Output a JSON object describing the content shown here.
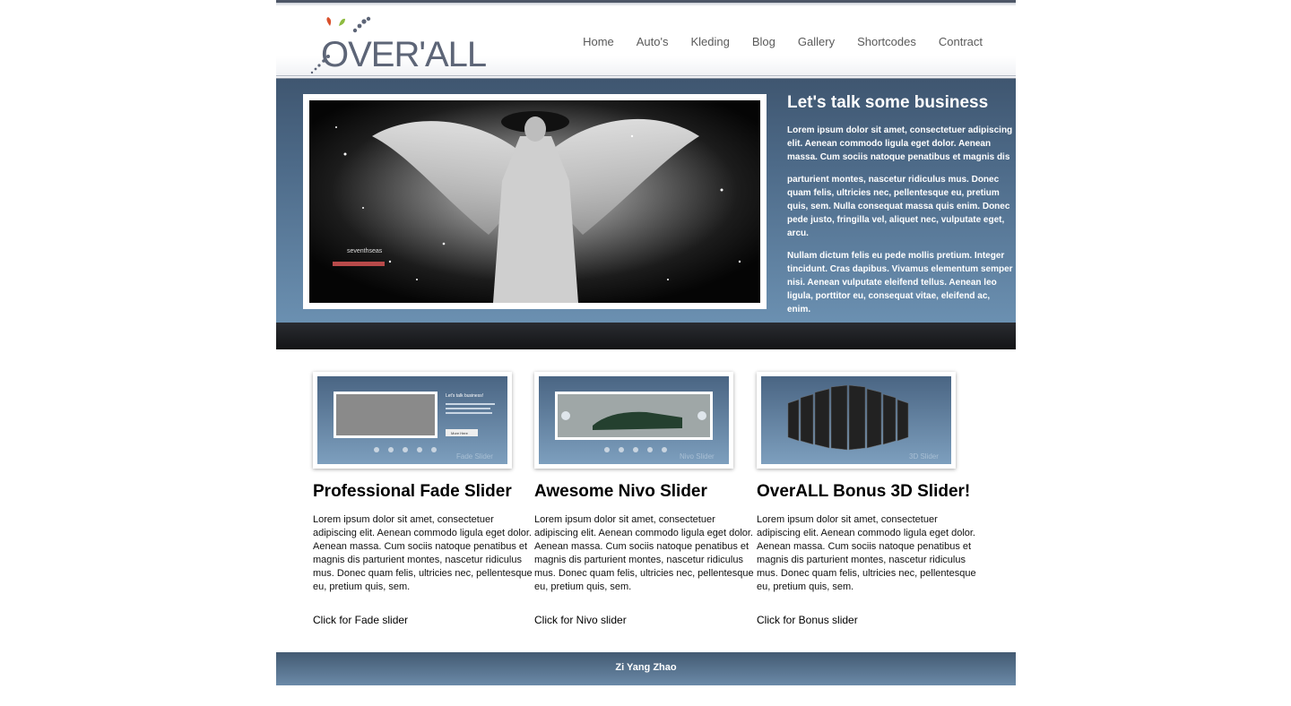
{
  "logo": {
    "text": "OVER'ALL"
  },
  "nav": {
    "items": [
      "Home",
      "Auto's",
      "Kleding",
      "Blog",
      "Gallery",
      "Shortcodes",
      "Contract"
    ]
  },
  "hero": {
    "title": "Let's talk some business",
    "paragraphs": [
      "Lorem ipsum dolor sit amet, consectetuer adipiscing elit. Aenean commodo ligula eget dolor. Aenean massa. Cum sociis natoque penatibus et magnis dis",
      "parturient montes, nascetur ridiculus mus. Donec quam felis, ultricies nec, pellentesque eu, pretium quis, sem. Nulla consequat massa quis enim. Donec pede justo, fringilla vel, aliquet nec, vulputate eget, arcu.",
      "Nullam dictum felis eu pede mollis pretium. Integer tincidunt. Cras dapibus. Vivamus elementum semper nisi. Aenean vulputate eleifend tellus. Aenean leo ligula, porttitor eu, consequat vitae, eleifend ac, enim."
    ],
    "photo_watermark": "seventhseas"
  },
  "features": [
    {
      "title": "Professional Fade Slider",
      "text": "Lorem ipsum dolor sit amet, consectetuer adipiscing elit. Aenean commodo ligula eget dolor. Aenean massa. Cum sociis natoque penatibus et magnis dis parturient montes, nascetur ridiculus mus. Donec quam felis, ultricies nec, pellentesque eu, pretium quis, sem.",
      "link": "Click for Fade slider",
      "thumb_label": "Fade Slider",
      "thumb_heading": "Let's talk business!",
      "thumb_button": "More Here"
    },
    {
      "title": "Awesome Nivo Slider",
      "text": "Lorem ipsum dolor sit amet, consectetuer adipiscing elit. Aenean commodo ligula eget dolor. Aenean massa. Cum sociis natoque penatibus et magnis dis parturient montes, nascetur ridiculus mus. Donec quam felis, ultricies nec, pellentesque eu, pretium quis, sem.",
      "link": "Click for Nivo slider",
      "thumb_label": "Nivo Slider"
    },
    {
      "title": "OverALL Bonus 3D Slider!",
      "text": "Lorem ipsum dolor sit amet, consectetuer adipiscing elit. Aenean commodo ligula eget dolor. Aenean massa. Cum sociis natoque penatibus et magnis dis parturient montes, nascetur ridiculus mus. Donec quam felis, ultricies nec, pellentesque eu, pretium quis, sem.",
      "link": "Click for Bonus slider",
      "thumb_label": "3D Slider"
    }
  ],
  "footer": {
    "text": "Zi Yang Zhao"
  },
  "colors": {
    "header_border": "#4d5666",
    "hero_top": "#3f5670",
    "hero_bottom": "#6b90b1",
    "nav_text": "#5a5a5a",
    "footer_bg": "#4f6a85"
  }
}
